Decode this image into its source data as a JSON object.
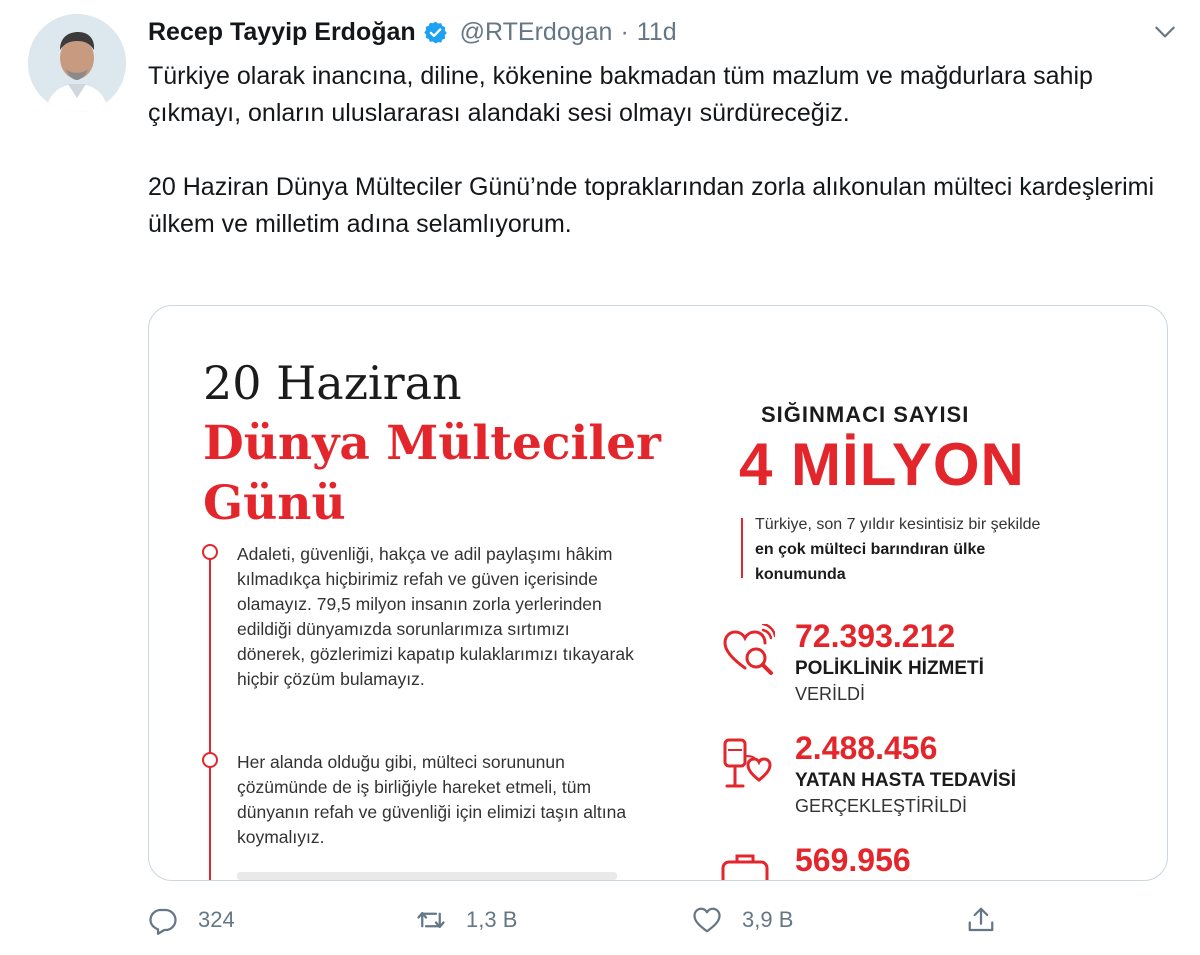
{
  "tweet": {
    "author_name": "Recep Tayyip Erdoğan",
    "handle": "@RTErdogan",
    "separator": "·",
    "time": "11d",
    "text_p1": "Türkiye olarak inancına, diline, kökenine bakmadan tüm mazlum ve mağdurlara sahip çıkmayı, onların uluslararası alandaki sesi olmayı sürdüreceğiz.",
    "text_p2": "20 Haziran Dünya Mülteciler Günü’nde topraklarından zorla alıkonulan mülteci kardeşlerimi ülkem ve milletim adına selamlıyorum."
  },
  "infographic": {
    "title_line1": "20 Haziran",
    "title_line2": "Dünya Mülteciler Günü",
    "paragraph1": "Adaleti, güvenliği, hakça ve adil paylaşımı hâkim kılmadıkça hiçbirimiz refah ve güven içerisinde olamayız. 79,5 milyon insanın zorla yerlerinden edildiği dünyamızda sorunlarımıza sırtımızı dönerek, gözlerimizi kapatıp kulaklarımızı tıkayarak hiçbir çözüm bulamayız.",
    "paragraph2": "Her alanda olduğu gibi, mülteci sorununun çözümünde de iş birliğiyle hareket etmeli, tüm dünyanın refah ve güvenliği için elimizi taşın altına koymalıyız.",
    "refugee_label": "SIĞINMACI SAYISI",
    "refugee_count": "4 MİLYON",
    "note_prefix": "Türkiye, son 7 yıldır kesintisiz bir şekilde",
    "note_bold": "en çok mülteci barındıran ülke konumunda",
    "stats": [
      {
        "number": "72.393.212",
        "line1": "POLİKLİNİK HİZMETİ",
        "line2": "VERİLDİ",
        "icon": "heart-search-icon"
      },
      {
        "number": "2.488.456",
        "line1": "YATAN HASTA TEDAVİSİ",
        "line2": "GERÇEKLEŞTİRİLDİ",
        "icon": "iv-drip-icon"
      },
      {
        "number": "569.956",
        "icon": "medical-bag-icon"
      }
    ]
  },
  "actions": {
    "replies": "324",
    "retweets": "1,3 B",
    "likes": "3,9 B",
    "reply_icon": "reply-icon",
    "retweet_icon": "retweet-icon",
    "like_icon": "heart-icon",
    "share_icon": "share-icon"
  },
  "colors": {
    "brand_red": "#e3262b",
    "verified_blue": "#1da1f2",
    "muted": "#657786"
  }
}
